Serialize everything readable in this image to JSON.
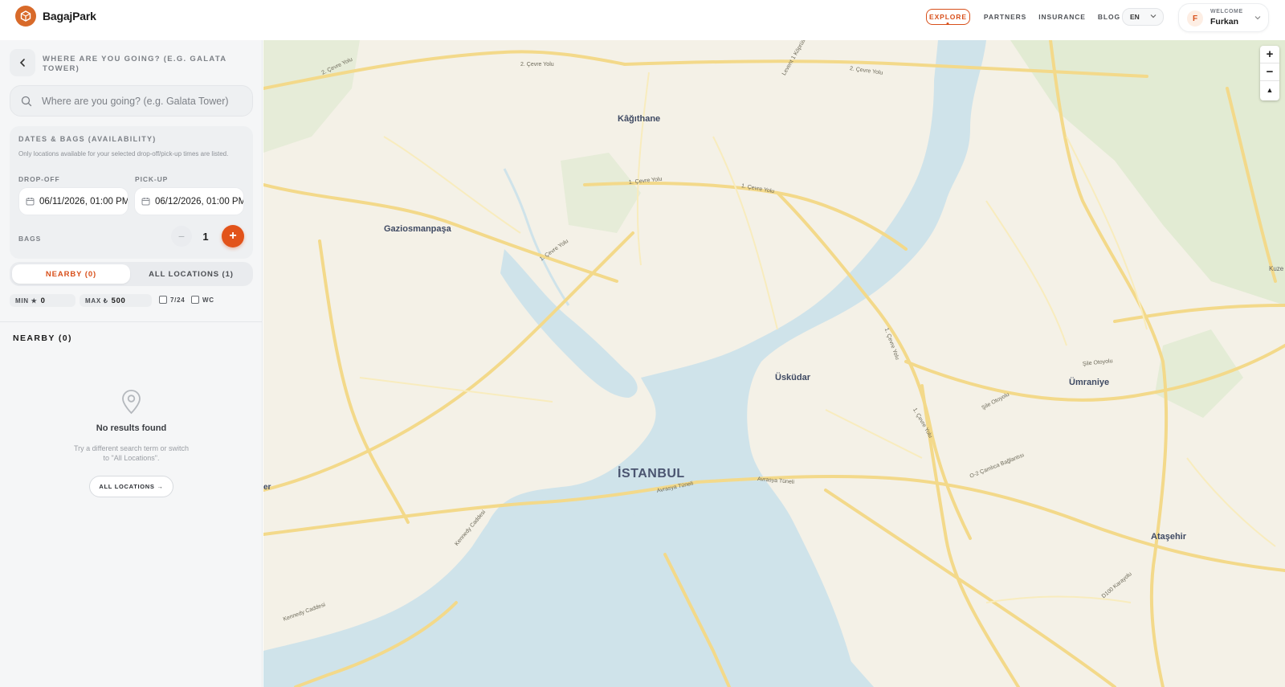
{
  "header": {
    "brand_name": "BagajPark",
    "nav": [
      {
        "label": "EXPLORE",
        "active": true
      },
      {
        "label": "PARTNERS",
        "active": false
      },
      {
        "label": "INSURANCE",
        "active": false
      },
      {
        "label": "BLOG",
        "active": false
      }
    ],
    "language": "EN",
    "user": {
      "initial": "F",
      "welcome_label": "WELCOME",
      "name": "Furkan"
    }
  },
  "sidebar": {
    "where_label": "WHERE ARE YOU GOING? (E.G. GALATA TOWER)",
    "search_placeholder": "Where are you going? (e.g. Galata Tower)",
    "dates": {
      "title": "DATES & BAGS (AVAILABILITY)",
      "note": "Only locations available for your selected drop-off/pick-up times are listed.",
      "dropoff_label": "DROP-OFF",
      "dropoff_value": "06/11/2026, 01:00 PM",
      "pickup_label": "PICK-UP",
      "pickup_value": "06/12/2026, 01:00 PM",
      "bags_label": "BAGS",
      "bags_count": "1"
    },
    "tabs": {
      "nearby": "NEARBY (0)",
      "all": "ALL LOCATIONS (1)"
    },
    "filters": {
      "min_label": "MIN ★",
      "min_value": "0",
      "max_label": "MAX ₺",
      "max_value": "500",
      "open_247": "7/24",
      "wc": "WC"
    },
    "list_title": "NEARBY (0)",
    "empty": {
      "title": "No results found",
      "subtitle": "Try a different search term or switch to \"All Locations\".",
      "button": "ALL LOCATIONS →"
    }
  },
  "map": {
    "districts": [
      "Kâğıthane",
      "Gaziosmanpaşa",
      "Üsküdar",
      "Ümraniye",
      "Ataşehir",
      "İSTANBUL"
    ],
    "roads": [
      "2. Çevre Yolu",
      "1. Çevre Yolu",
      "Avrasya Tüneli",
      "Kennedy Caddesi",
      "Şile Otoyolu",
      "O-2 Çamlıca Bağlantısı",
      "D100 Karayolu",
      "Levent 1 Köprüsü"
    ],
    "edge_labels": [
      "er",
      "Kuze"
    ],
    "controls": {
      "zoom_in": "+",
      "zoom_out": "−",
      "compass": "▲"
    },
    "colors": {
      "land": "#f4f1e7",
      "water": "#cfe3ea",
      "park": "#dde9cf",
      "road": "#f6dc8a"
    }
  }
}
